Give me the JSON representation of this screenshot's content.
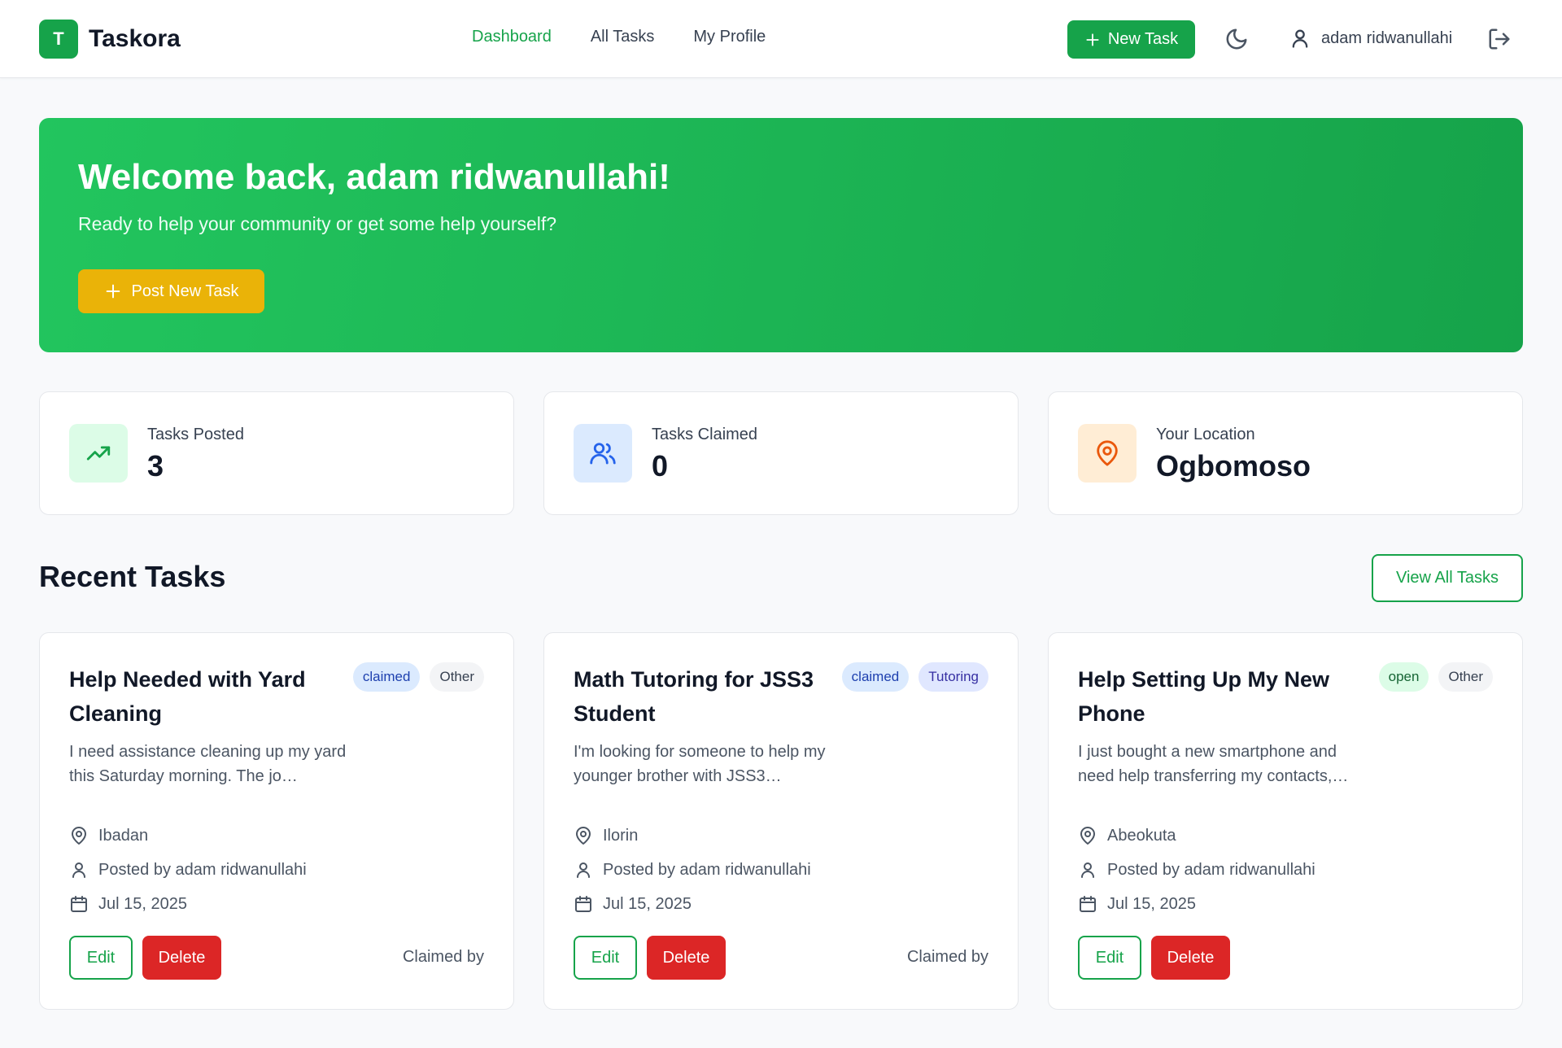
{
  "header": {
    "logo_letter": "T",
    "app_name": "Taskora",
    "nav": [
      {
        "label": "Dashboard",
        "active": true
      },
      {
        "label": "All Tasks",
        "active": false
      },
      {
        "label": "My Profile",
        "active": false
      }
    ],
    "new_task_label": "New Task",
    "user_name": "adam ridwanullahi"
  },
  "hero": {
    "title": "Welcome back, adam ridwanullahi!",
    "subtitle": "Ready to help your community or get some help yourself?",
    "button_label": "Post New Task"
  },
  "stats": [
    {
      "label": "Tasks Posted",
      "value": "3",
      "icon": "trending-up-icon"
    },
    {
      "label": "Tasks Claimed",
      "value": "0",
      "icon": "users-icon"
    },
    {
      "label": "Your Location",
      "value": "Ogbomoso",
      "icon": "map-pin-icon"
    }
  ],
  "recent": {
    "title": "Recent Tasks",
    "view_all_label": "View All Tasks"
  },
  "tasks": [
    {
      "title": "Help Needed with Yard Cleaning",
      "status": "claimed",
      "category": "Other",
      "description": "I need assistance cleaning up my yard this Saturday morning. The jo…",
      "location": "Ibadan",
      "posted_by": "Posted by adam ridwanullahi",
      "date": "Jul 15, 2025",
      "edit_label": "Edit",
      "delete_label": "Delete",
      "claimed_by": "Claimed by"
    },
    {
      "title": "Math Tutoring for JSS3 Student",
      "status": "claimed",
      "category": "Tutoring",
      "description": "I'm looking for someone to help my younger brother with JSS3…",
      "location": "Ilorin",
      "posted_by": "Posted by adam ridwanullahi",
      "date": "Jul 15, 2025",
      "edit_label": "Edit",
      "delete_label": "Delete",
      "claimed_by": "Claimed by"
    },
    {
      "title": "Help Setting Up My New Phone",
      "status": "open",
      "category": "Other",
      "description": "I just bought a new smartphone and need help transferring my contacts,…",
      "location": "Abeokuta",
      "posted_by": "Posted by adam ridwanullahi",
      "date": "Jul 15, 2025",
      "edit_label": "Edit",
      "delete_label": "Delete",
      "claimed_by": ""
    }
  ],
  "colors": {
    "brand": "#16a34a",
    "accent": "#eab308",
    "danger": "#dc2626"
  }
}
